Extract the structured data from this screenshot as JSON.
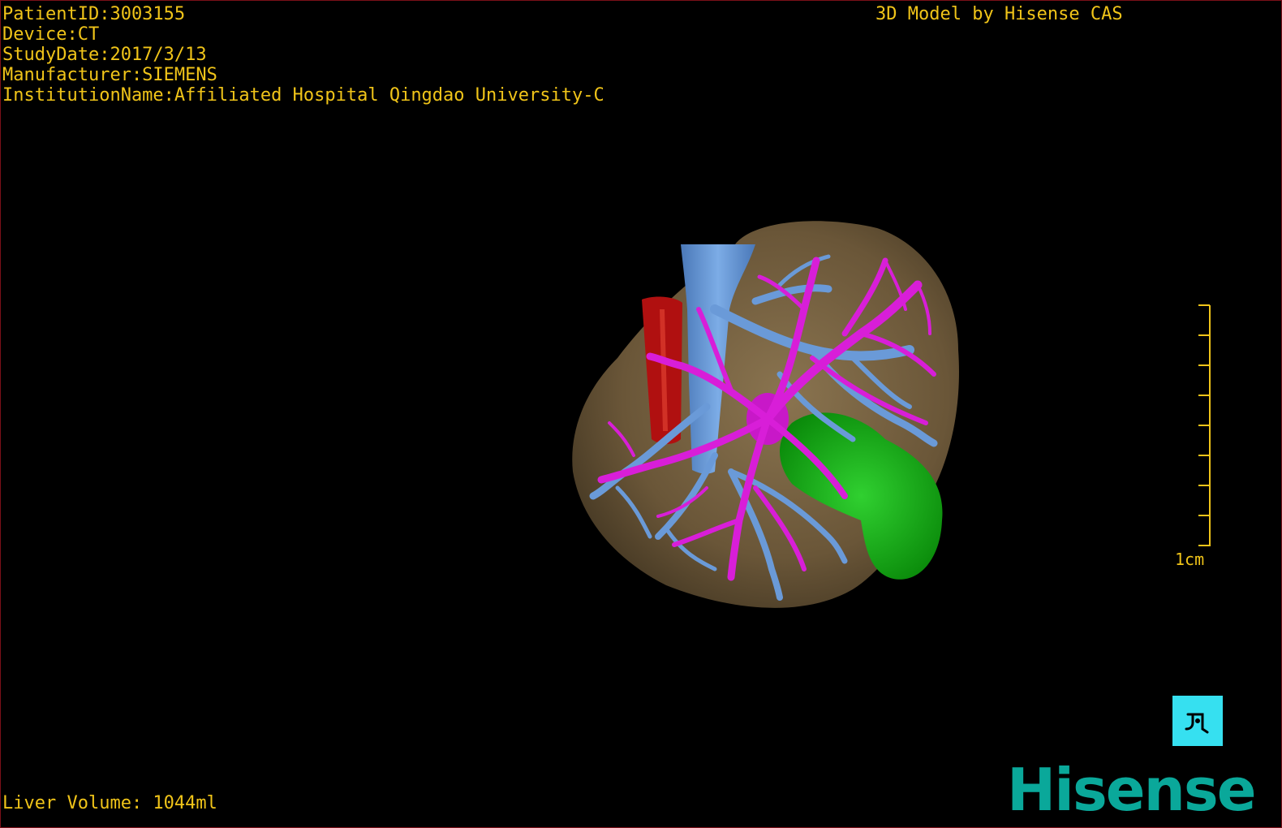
{
  "header": {
    "patient_id": "PatientID:3003155",
    "device": "Device:CT",
    "study_date": "StudyDate:2017/3/13",
    "manufacturer": "Manufacturer:SIEMENS",
    "institution": "InstitutionName:Affiliated Hospital Qingdao University-C",
    "model_credit": "3D Model by Hisense CAS"
  },
  "footer": {
    "liver_volume": "Liver Volume: 1044ml"
  },
  "scale": {
    "label": "1cm"
  },
  "orientation_button": {
    "icon": "orientation-figure-icon"
  },
  "brand": {
    "logo_text": "Hisense"
  },
  "colors": {
    "overlay_text": "#f0c419",
    "liver": "#6e5a3c",
    "portal_vein": "#d21cd2",
    "hepatic_vein": "#5a8fd0",
    "aorta": "#b01010",
    "gallbladder": "#14b414",
    "orientation_button": "#36e0f0",
    "logo": "#0aa89a"
  }
}
